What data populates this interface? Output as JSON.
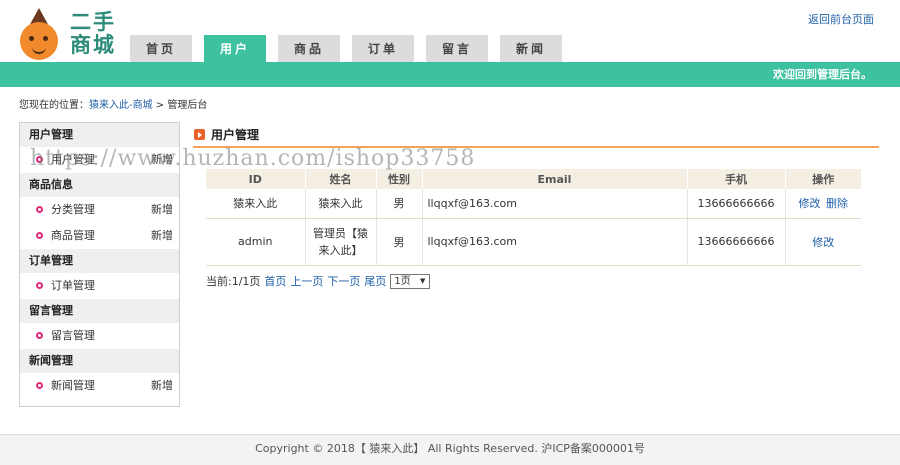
{
  "logo": {
    "line1": "二手",
    "line2": "商城"
  },
  "header": {
    "back_link": "返回前台页面"
  },
  "nav": {
    "tabs": [
      "首页",
      "用户",
      "商品",
      "订单",
      "留言",
      "新闻"
    ],
    "active": "用户"
  },
  "banner": {
    "welcome": "欢迎回到管理后台。"
  },
  "breadcrumb": {
    "prefix": "您现在的位置：",
    "link": "猿来入此-商城",
    "sep": " > ",
    "current": "管理后台"
  },
  "sidebar": {
    "groups": [
      {
        "title": "用户管理",
        "items": [
          {
            "label": "用户管理",
            "add": "新增"
          }
        ]
      },
      {
        "title": "商品信息",
        "items": [
          {
            "label": "分类管理",
            "add": "新增"
          },
          {
            "label": "商品管理",
            "add": "新增"
          }
        ]
      },
      {
        "title": "订单管理",
        "items": [
          {
            "label": "订单管理",
            "add": ""
          }
        ]
      },
      {
        "title": "留言管理",
        "items": [
          {
            "label": "留言管理",
            "add": ""
          }
        ]
      },
      {
        "title": "新闻管理",
        "items": [
          {
            "label": "新闻管理",
            "add": "新增"
          }
        ]
      }
    ]
  },
  "main": {
    "title": "用户管理",
    "columns": [
      "ID",
      "姓名",
      "性别",
      "Email",
      "手机",
      "操作"
    ],
    "rows": [
      {
        "id": "猿来入此",
        "name": "猿来入此",
        "gender": "男",
        "email": "llqqxf@163.com",
        "phone": "13666666666",
        "edit": "修改",
        "delete": "删除"
      },
      {
        "id": "admin",
        "name": "管理员【猿来入此】",
        "gender": "男",
        "email": "llqqxf@163.com",
        "phone": "13666666666",
        "edit": "修改",
        "delete": ""
      }
    ],
    "pager": {
      "status": "当前:1/1页",
      "first": "首页",
      "prev": "上一页",
      "next": "下一页",
      "last": "尾页",
      "select": "1页"
    }
  },
  "watermark": "https://www.huzhan.com/ishop33758",
  "footer": {
    "text": "Copyright © 2018【 猿来入此】 All Rights Reserved. 沪ICP备案000001号"
  },
  "colors": {
    "accent": "#3ec19f",
    "title_rule": "#f4a259",
    "bullet": "#e0287a"
  }
}
